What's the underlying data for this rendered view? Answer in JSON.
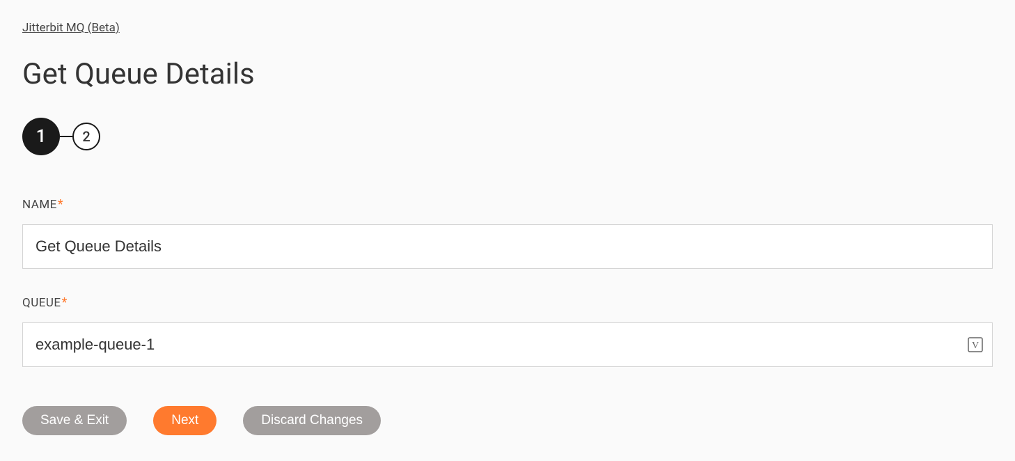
{
  "breadcrumb": {
    "label": "Jitterbit MQ (Beta)"
  },
  "page": {
    "title": "Get Queue Details"
  },
  "stepper": {
    "steps": [
      {
        "label": "1",
        "active": true
      },
      {
        "label": "2",
        "active": false
      }
    ]
  },
  "form": {
    "name": {
      "label": "NAME",
      "required_marker": "*",
      "value": "Get Queue Details"
    },
    "queue": {
      "label": "QUEUE",
      "required_marker": "*",
      "value": "example-queue-1"
    }
  },
  "buttons": {
    "save_exit": "Save & Exit",
    "next": "Next",
    "discard": "Discard Changes"
  }
}
